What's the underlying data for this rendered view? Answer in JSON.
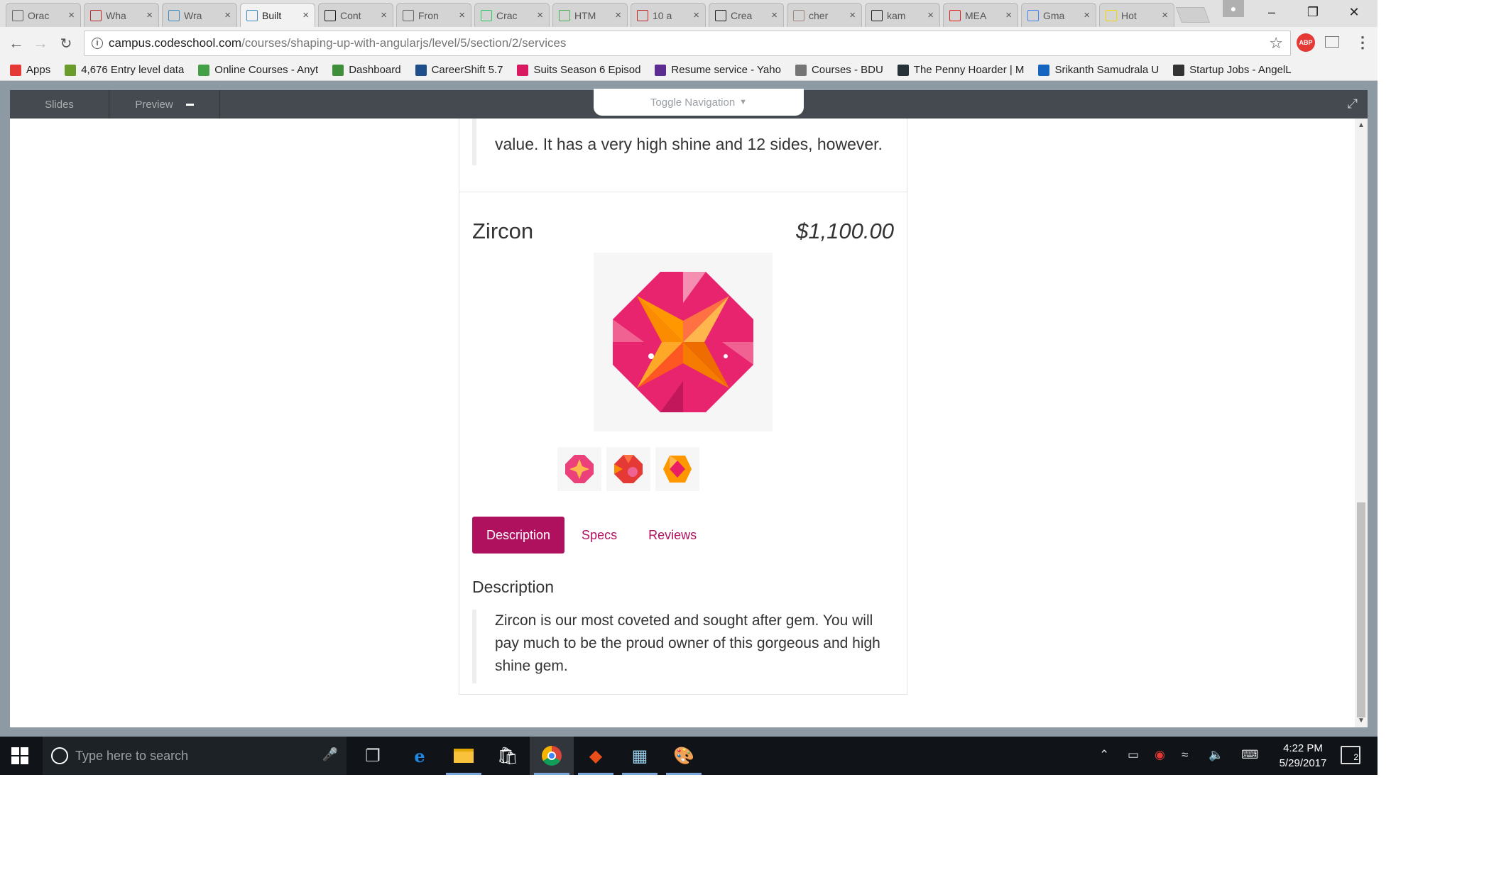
{
  "browser": {
    "tabs": [
      {
        "label": "Orac",
        "icon": "document-icon",
        "color": "#666666"
      },
      {
        "label": "Wha",
        "icon": "quora-icon",
        "color": "#b92b27"
      },
      {
        "label": "Wra",
        "icon": "codeschool-icon",
        "color": "#3d8fc4"
      },
      {
        "label": "Built",
        "icon": "codeschool-icon",
        "color": "#3d8fc4",
        "active": true
      },
      {
        "label": "Cont",
        "icon": "github-icon",
        "color": "#222222"
      },
      {
        "label": "Fron",
        "icon": "document-icon",
        "color": "#666666"
      },
      {
        "label": "Crac",
        "icon": "hackerrank-icon",
        "color": "#2ec866"
      },
      {
        "label": "HTM",
        "icon": "w3schools-icon",
        "color": "#4caf50"
      },
      {
        "label": "10 a",
        "icon": "medium-icon",
        "color": "#c62828"
      },
      {
        "label": "Crea",
        "icon": "js-icon",
        "color": "#222222"
      },
      {
        "label": "cher",
        "icon": "avatar-icon",
        "color": "#a1887f"
      },
      {
        "label": "kam",
        "icon": "github-icon",
        "color": "#222222"
      },
      {
        "label": "MEA",
        "icon": "youtube-icon",
        "color": "#e62117"
      },
      {
        "label": "Gma",
        "icon": "google-icon",
        "color": "#4285f4"
      },
      {
        "label": "Hot",
        "icon": "bestbuy-icon",
        "color": "#f5d800"
      }
    ],
    "address": {
      "host": "campus.codeschool.com",
      "path": "/courses/shaping-up-with-angularjs/level/5/section/2/services"
    },
    "extensions": {
      "abp": "ABP"
    },
    "bookmarks": [
      {
        "label": "Apps",
        "color": "#e53935"
      },
      {
        "label": "4,676 Entry level data",
        "color": "#6a9c2c"
      },
      {
        "label": "Online Courses - Anyt",
        "color": "#43a047"
      },
      {
        "label": "Dashboard",
        "color": "#3f8f3a"
      },
      {
        "label": "CareerShift 5.7",
        "color": "#1e4f8a"
      },
      {
        "label": "Suits Season 6 Episod",
        "color": "#d81b60"
      },
      {
        "label": "Resume service - Yaho",
        "color": "#5c2d91"
      },
      {
        "label": "Courses - BDU",
        "color": "#757575"
      },
      {
        "label": "The Penny Hoarder | M",
        "color": "#263238"
      },
      {
        "label": "Srikanth Samudrala U",
        "color": "#1565c0"
      },
      {
        "label": "Startup Jobs - AngelL",
        "color": "#333333"
      }
    ]
  },
  "course": {
    "slides_label": "Slides",
    "preview_label": "Preview",
    "toggle_nav_label": "Toggle Navigation"
  },
  "product": {
    "previous_description_tail": "value. It has a very high shine and 12 sides, however.",
    "name": "Zircon",
    "price": "$1,100.00",
    "tabs": [
      "Description",
      "Specs",
      "Reviews"
    ],
    "active_tab": "Description",
    "description_heading": "Description",
    "description": "Zircon is our most coveted and sought after gem. You will pay much to be the proud owner of this gorgeous and high shine gem.",
    "colors": {
      "accent": "#b0115f",
      "gem_pink": "#e91e63",
      "gem_orange": "#ff9800"
    }
  },
  "taskbar": {
    "search_placeholder": "Type here to search",
    "time": "4:22 PM",
    "date": "5/29/2017",
    "notifications": "2"
  }
}
